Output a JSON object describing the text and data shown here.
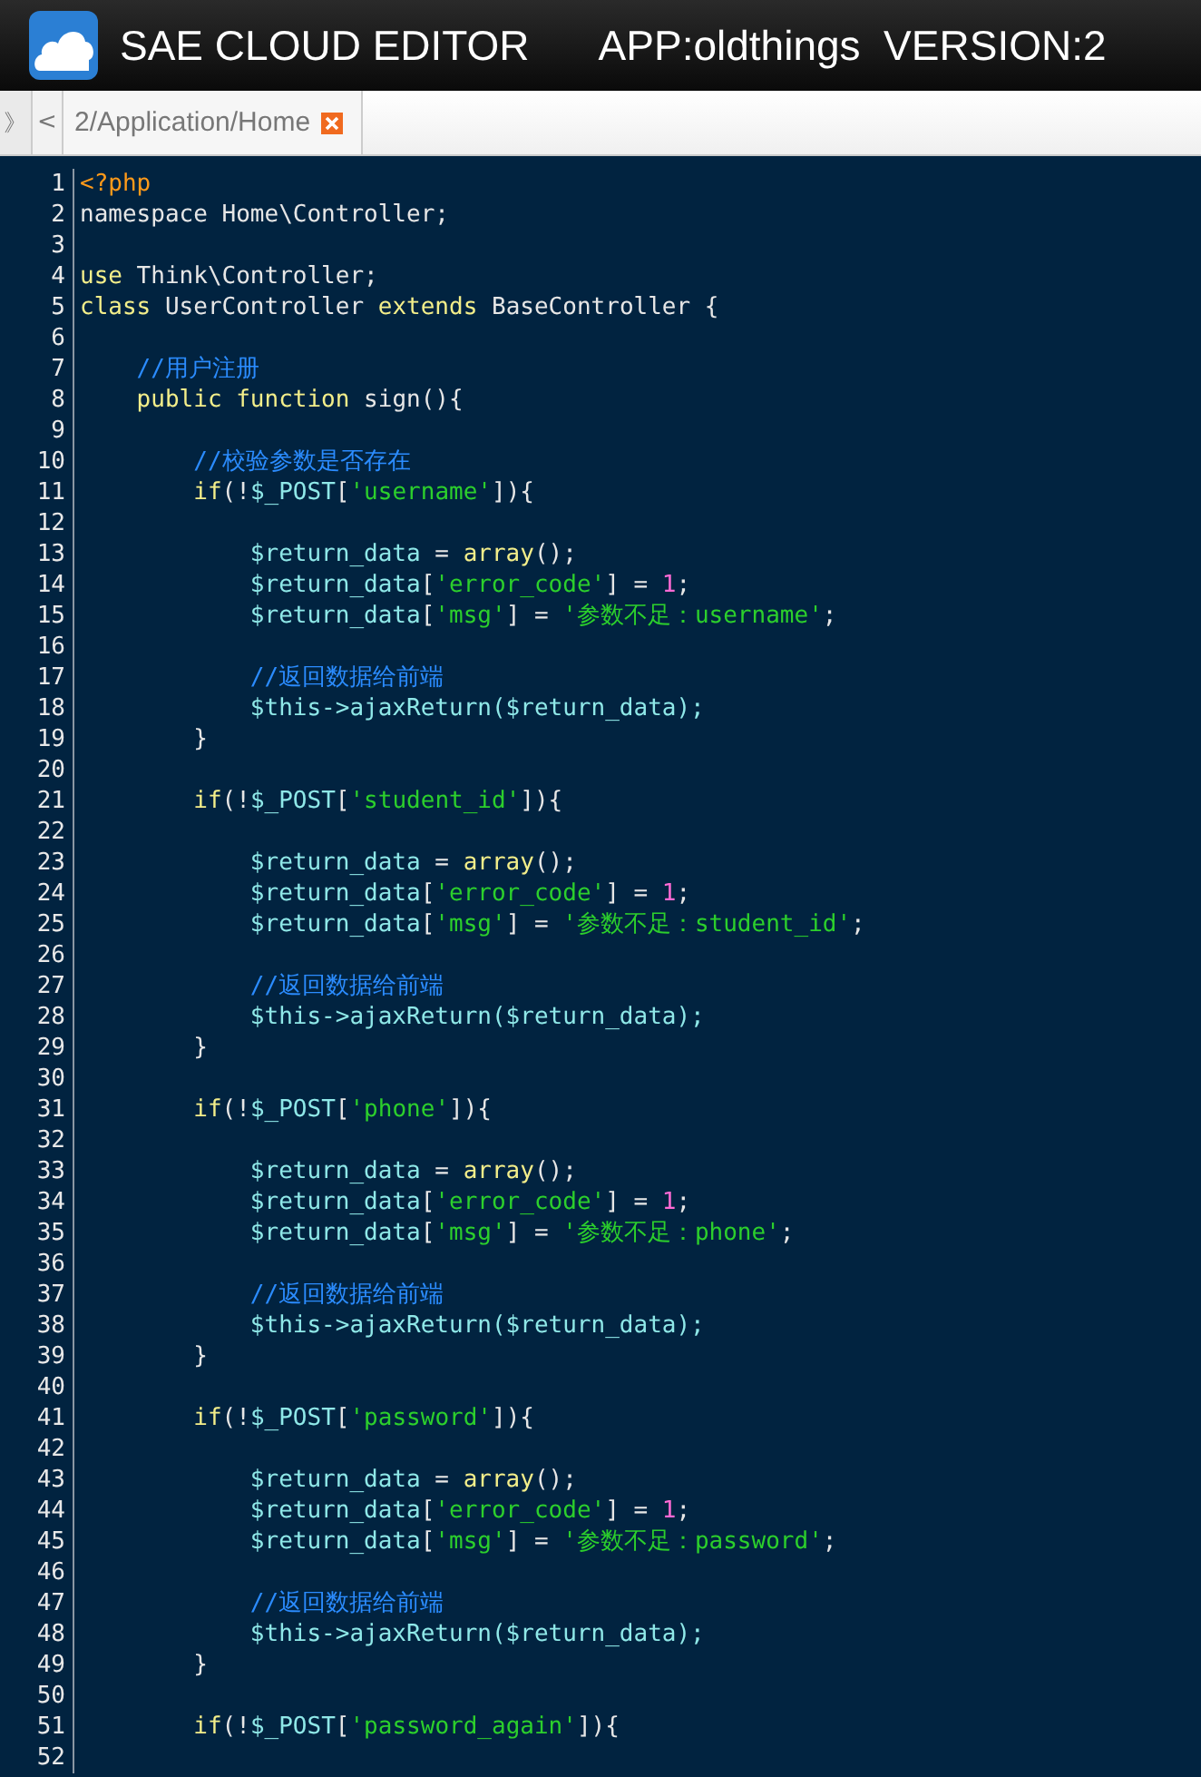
{
  "window": {
    "title": "SAE CLOUD EDITOR",
    "app_info": "APP:oldthings  VERSION:2"
  },
  "tab_bar": {
    "collapse": "》",
    "scroll_left": "<",
    "tabs": [
      {
        "label": "2/Application/Home",
        "selected": true
      }
    ]
  },
  "editor": {
    "lines": [
      {
        "number": "1",
        "tokens": [
          {
            "kind": "tag",
            "text": "<?php"
          }
        ]
      },
      {
        "number": "2",
        "tokens": [
          {
            "kind": "plain",
            "text": "namespace Home\\Controller;"
          }
        ]
      },
      {
        "number": "3"
      },
      {
        "number": "4",
        "tokens": [
          {
            "kind": "kw",
            "text": "use"
          },
          {
            "kind": "plain",
            "text": " Think\\Controller;"
          }
        ]
      },
      {
        "number": "5",
        "tokens": [
          {
            "kind": "kw",
            "text": "class"
          },
          {
            "kind": "plain",
            "text": " UserController "
          },
          {
            "kind": "kw",
            "text": "extends"
          },
          {
            "kind": "plain",
            "text": " BaseController {"
          }
        ]
      },
      {
        "number": "6"
      },
      {
        "number": "7",
        "tokens": [
          {
            "kind": "com",
            "text": "    //用户注册"
          }
        ]
      },
      {
        "number": "8",
        "tokens": [
          {
            "kind": "kw",
            "text": "    public function"
          },
          {
            "kind": "plain",
            "text": " sign(){"
          }
        ]
      },
      {
        "number": "9"
      },
      {
        "number": "10",
        "tokens": [
          {
            "kind": "com",
            "text": "        //校验参数是否存在"
          }
        ]
      },
      {
        "number": "11",
        "tokens": [
          {
            "kind": "kw",
            "text": "        if"
          },
          {
            "kind": "plain",
            "text": "(!"
          },
          {
            "kind": "var",
            "text": "$_POST"
          },
          {
            "kind": "plain",
            "text": "["
          },
          {
            "kind": "str",
            "text": "'username'"
          },
          {
            "kind": "plain",
            "text": "]){"
          }
        ]
      },
      {
        "number": "12"
      },
      {
        "number": "13",
        "tokens": [
          {
            "kind": "var",
            "text": "            $return_data"
          },
          {
            "kind": "plain",
            "text": " = "
          },
          {
            "kind": "kw",
            "text": "array"
          },
          {
            "kind": "plain",
            "text": "();"
          }
        ]
      },
      {
        "number": "14",
        "tokens": [
          {
            "kind": "var",
            "text": "            $return_data"
          },
          {
            "kind": "plain",
            "text": "["
          },
          {
            "kind": "str",
            "text": "'error_code'"
          },
          {
            "kind": "plain",
            "text": "] = "
          },
          {
            "kind": "num",
            "text": "1"
          },
          {
            "kind": "plain",
            "text": ";"
          }
        ]
      },
      {
        "number": "15",
        "tokens": [
          {
            "kind": "var",
            "text": "            $return_data"
          },
          {
            "kind": "plain",
            "text": "["
          },
          {
            "kind": "str",
            "text": "'msg'"
          },
          {
            "kind": "plain",
            "text": "] = "
          },
          {
            "kind": "str",
            "text": "'参数不足：username'"
          },
          {
            "kind": "plain",
            "text": ";"
          }
        ]
      },
      {
        "number": "16"
      },
      {
        "number": "17",
        "tokens": [
          {
            "kind": "com",
            "text": "            //返回数据给前端"
          }
        ]
      },
      {
        "number": "18",
        "tokens": [
          {
            "kind": "var",
            "text": "            $this->ajaxReturn($return_data);"
          }
        ]
      },
      {
        "number": "19",
        "tokens": [
          {
            "kind": "plain",
            "text": "        }"
          }
        ]
      },
      {
        "number": "20"
      },
      {
        "number": "21",
        "tokens": [
          {
            "kind": "kw",
            "text": "        if"
          },
          {
            "kind": "plain",
            "text": "(!"
          },
          {
            "kind": "var",
            "text": "$_POST"
          },
          {
            "kind": "plain",
            "text": "["
          },
          {
            "kind": "str",
            "text": "'student_id'"
          },
          {
            "kind": "plain",
            "text": "]){"
          }
        ]
      },
      {
        "number": "22"
      },
      {
        "number": "23",
        "tokens": [
          {
            "kind": "var",
            "text": "            $return_data"
          },
          {
            "kind": "plain",
            "text": " = "
          },
          {
            "kind": "kw",
            "text": "array"
          },
          {
            "kind": "plain",
            "text": "();"
          }
        ]
      },
      {
        "number": "24",
        "tokens": [
          {
            "kind": "var",
            "text": "            $return_data"
          },
          {
            "kind": "plain",
            "text": "["
          },
          {
            "kind": "str",
            "text": "'error_code'"
          },
          {
            "kind": "plain",
            "text": "] = "
          },
          {
            "kind": "num",
            "text": "1"
          },
          {
            "kind": "plain",
            "text": ";"
          }
        ]
      },
      {
        "number": "25",
        "tokens": [
          {
            "kind": "var",
            "text": "            $return_data"
          },
          {
            "kind": "plain",
            "text": "["
          },
          {
            "kind": "str",
            "text": "'msg'"
          },
          {
            "kind": "plain",
            "text": "] = "
          },
          {
            "kind": "str",
            "text": "'参数不足：student_id'"
          },
          {
            "kind": "plain",
            "text": ";"
          }
        ]
      },
      {
        "number": "26"
      },
      {
        "number": "27",
        "tokens": [
          {
            "kind": "com",
            "text": "            //返回数据给前端"
          }
        ]
      },
      {
        "number": "28",
        "tokens": [
          {
            "kind": "var",
            "text": "            $this->ajaxReturn($return_data);"
          }
        ]
      },
      {
        "number": "29",
        "tokens": [
          {
            "kind": "plain",
            "text": "        }"
          }
        ]
      },
      {
        "number": "30"
      },
      {
        "number": "31",
        "tokens": [
          {
            "kind": "kw",
            "text": "        if"
          },
          {
            "kind": "plain",
            "text": "(!"
          },
          {
            "kind": "var",
            "text": "$_POST"
          },
          {
            "kind": "plain",
            "text": "["
          },
          {
            "kind": "str",
            "text": "'phone'"
          },
          {
            "kind": "plain",
            "text": "]){"
          }
        ]
      },
      {
        "number": "32"
      },
      {
        "number": "33",
        "tokens": [
          {
            "kind": "var",
            "text": "            $return_data"
          },
          {
            "kind": "plain",
            "text": " = "
          },
          {
            "kind": "kw",
            "text": "array"
          },
          {
            "kind": "plain",
            "text": "();"
          }
        ]
      },
      {
        "number": "34",
        "tokens": [
          {
            "kind": "var",
            "text": "            $return_data"
          },
          {
            "kind": "plain",
            "text": "["
          },
          {
            "kind": "str",
            "text": "'error_code'"
          },
          {
            "kind": "plain",
            "text": "] = "
          },
          {
            "kind": "num",
            "text": "1"
          },
          {
            "kind": "plain",
            "text": ";"
          }
        ]
      },
      {
        "number": "35",
        "tokens": [
          {
            "kind": "var",
            "text": "            $return_data"
          },
          {
            "kind": "plain",
            "text": "["
          },
          {
            "kind": "str",
            "text": "'msg'"
          },
          {
            "kind": "plain",
            "text": "] = "
          },
          {
            "kind": "str",
            "text": "'参数不足：phone'"
          },
          {
            "kind": "plain",
            "text": ";"
          }
        ]
      },
      {
        "number": "36"
      },
      {
        "number": "37",
        "tokens": [
          {
            "kind": "com",
            "text": "            //返回数据给前端"
          }
        ]
      },
      {
        "number": "38",
        "tokens": [
          {
            "kind": "var",
            "text": "            $this->ajaxReturn($return_data);"
          }
        ]
      },
      {
        "number": "39",
        "tokens": [
          {
            "kind": "plain",
            "text": "        }"
          }
        ]
      },
      {
        "number": "40"
      },
      {
        "number": "41",
        "tokens": [
          {
            "kind": "kw",
            "text": "        if"
          },
          {
            "kind": "plain",
            "text": "(!"
          },
          {
            "kind": "var",
            "text": "$_POST"
          },
          {
            "kind": "plain",
            "text": "["
          },
          {
            "kind": "str",
            "text": "'password'"
          },
          {
            "kind": "plain",
            "text": "]){"
          }
        ]
      },
      {
        "number": "42"
      },
      {
        "number": "43",
        "tokens": [
          {
            "kind": "var",
            "text": "            $return_data"
          },
          {
            "kind": "plain",
            "text": " = "
          },
          {
            "kind": "kw",
            "text": "array"
          },
          {
            "kind": "plain",
            "text": "();"
          }
        ]
      },
      {
        "number": "44",
        "tokens": [
          {
            "kind": "var",
            "text": "            $return_data"
          },
          {
            "kind": "plain",
            "text": "["
          },
          {
            "kind": "str",
            "text": "'error_code'"
          },
          {
            "kind": "plain",
            "text": "] = "
          },
          {
            "kind": "num",
            "text": "1"
          },
          {
            "kind": "plain",
            "text": ";"
          }
        ]
      },
      {
        "number": "45",
        "tokens": [
          {
            "kind": "var",
            "text": "            $return_data"
          },
          {
            "kind": "plain",
            "text": "["
          },
          {
            "kind": "str",
            "text": "'msg'"
          },
          {
            "kind": "plain",
            "text": "] = "
          },
          {
            "kind": "str",
            "text": "'参数不足：password'"
          },
          {
            "kind": "plain",
            "text": ";"
          }
        ]
      },
      {
        "number": "46"
      },
      {
        "number": "47",
        "tokens": [
          {
            "kind": "com",
            "text": "            //返回数据给前端"
          }
        ]
      },
      {
        "number": "48",
        "tokens": [
          {
            "kind": "var",
            "text": "            $this->ajaxReturn($return_data);"
          }
        ]
      },
      {
        "number": "49",
        "tokens": [
          {
            "kind": "plain",
            "text": "        }"
          }
        ]
      },
      {
        "number": "50"
      },
      {
        "number": "51",
        "tokens": [
          {
            "kind": "kw",
            "text": "        if"
          },
          {
            "kind": "plain",
            "text": "(!"
          },
          {
            "kind": "var",
            "text": "$_POST"
          },
          {
            "kind": "plain",
            "text": "["
          },
          {
            "kind": "str",
            "text": "'password_again'"
          },
          {
            "kind": "plain",
            "text": "]){"
          }
        ]
      },
      {
        "number": "52"
      }
    ]
  }
}
